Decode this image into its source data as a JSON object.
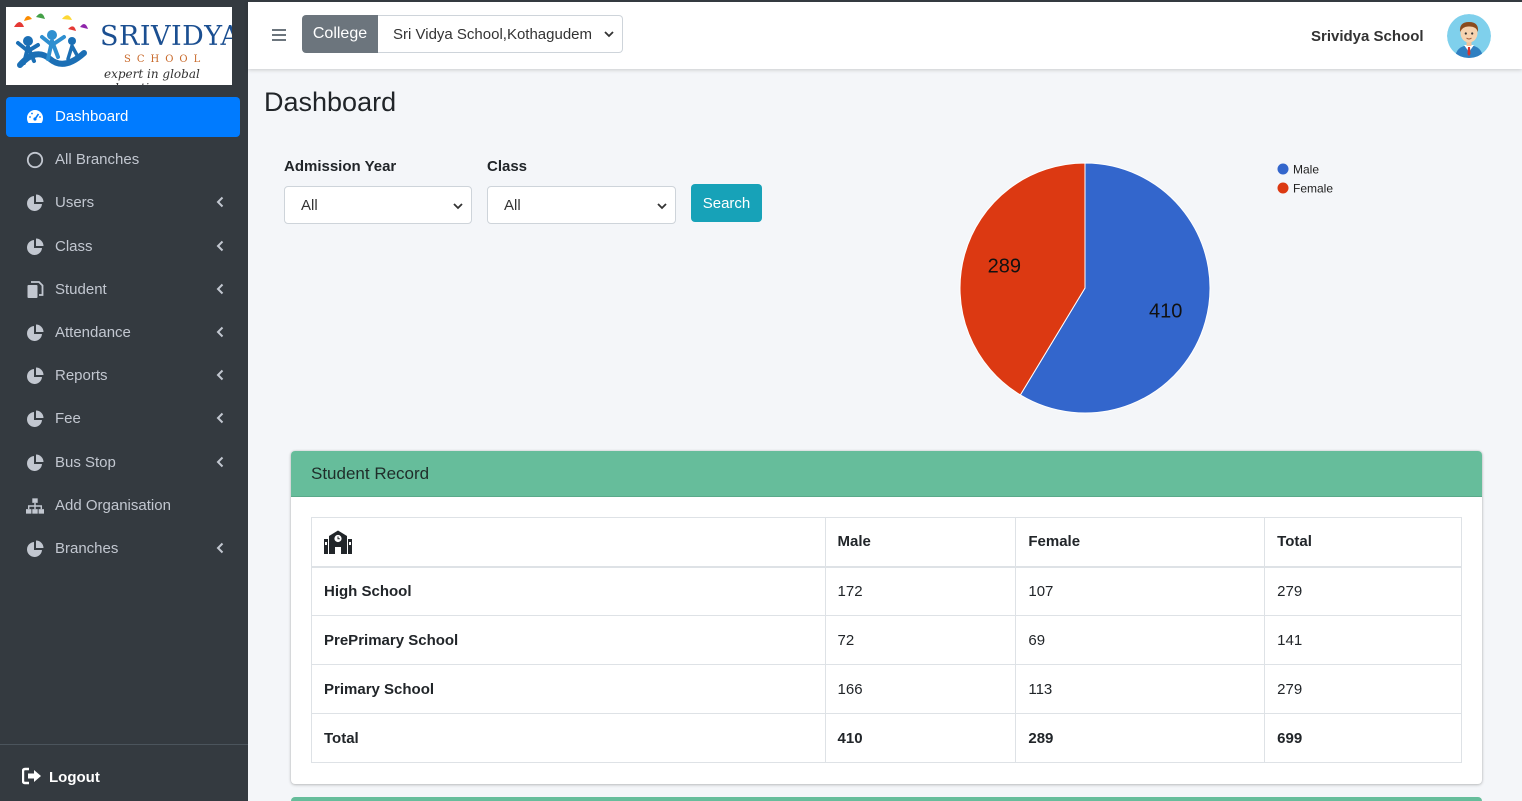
{
  "brand": {
    "name": "SRIVIDYA",
    "sub": "SCHOOL",
    "tagline": "expert in global education.."
  },
  "sidebar": {
    "items": [
      {
        "label": "Dashboard",
        "icon": "tachometer-icon",
        "active": true,
        "caret": false
      },
      {
        "label": "All Branches",
        "icon": "circle-icon",
        "active": false,
        "caret": false
      },
      {
        "label": "Users",
        "icon": "pie-chart-icon",
        "active": false,
        "caret": true
      },
      {
        "label": "Class",
        "icon": "pie-chart-icon",
        "active": false,
        "caret": true
      },
      {
        "label": "Student",
        "icon": "copy-icon",
        "active": false,
        "caret": true
      },
      {
        "label": "Attendance",
        "icon": "pie-chart-icon",
        "active": false,
        "caret": true
      },
      {
        "label": "Reports",
        "icon": "pie-chart-icon",
        "active": false,
        "caret": true
      },
      {
        "label": "Fee",
        "icon": "pie-chart-icon",
        "active": false,
        "caret": true
      },
      {
        "label": "Bus Stop",
        "icon": "pie-chart-icon",
        "active": false,
        "caret": true
      },
      {
        "label": "Add Organisation",
        "icon": "sitemap-icon",
        "active": false,
        "caret": false
      },
      {
        "label": "Branches",
        "icon": "pie-chart-icon",
        "active": false,
        "caret": true
      }
    ],
    "logout_label": "Logout"
  },
  "topbar": {
    "college_label": "College",
    "college_value": "Sri Vidya School,Kothagudem",
    "school_name": "Srividya School"
  },
  "page": {
    "title": "Dashboard"
  },
  "filters": {
    "admission_year_label": "Admission Year",
    "admission_year_value": "All",
    "class_label": "Class",
    "class_value": "All",
    "search_label": "Search"
  },
  "chart_data": {
    "type": "pie",
    "categories": [
      "Male",
      "Female"
    ],
    "values": [
      410,
      289
    ],
    "colors": [
      "#3366cc",
      "#dc3912"
    ],
    "legend": "top-right"
  },
  "record": {
    "title": "Student Record",
    "columns": [
      "Male",
      "Female",
      "Total"
    ],
    "rows": [
      {
        "label": "High School",
        "male": "172",
        "female": "107",
        "total": "279"
      },
      {
        "label": "PrePrimary School",
        "male": "72",
        "female": "69",
        "total": "141"
      },
      {
        "label": "Primary School",
        "male": "166",
        "female": "113",
        "total": "279"
      },
      {
        "label": "Total",
        "male": "410",
        "female": "289",
        "total": "699"
      }
    ]
  },
  "colors": {
    "sidebar_bg": "#343a40",
    "active": "#007bff",
    "card_header": "#66bd9b",
    "search_button": "#17a2b8"
  }
}
